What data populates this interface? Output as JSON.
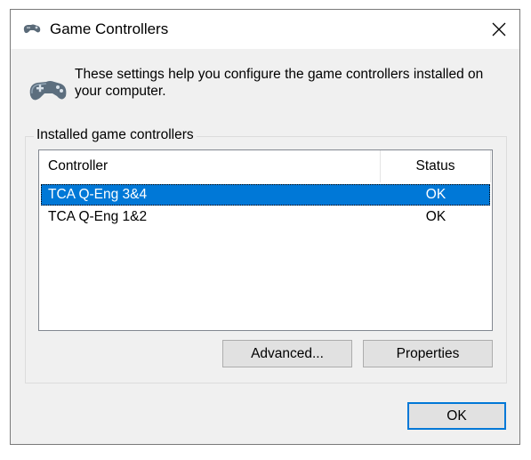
{
  "window": {
    "title": "Game Controllers",
    "title_icon": "gamepad-icon",
    "close_icon": "close-icon"
  },
  "info": {
    "icon": "gamepad-icon",
    "text": "These settings help you configure the game controllers installed on your computer."
  },
  "group": {
    "label": "Installed game controllers"
  },
  "list": {
    "columns": [
      "Controller",
      "Status"
    ],
    "rows": [
      {
        "controller": "TCA Q-Eng 3&4",
        "status": "OK",
        "selected": true
      },
      {
        "controller": "TCA Q-Eng 1&2",
        "status": "OK",
        "selected": false
      }
    ]
  },
  "buttons": {
    "advanced": "Advanced...",
    "properties": "Properties",
    "ok": "OK"
  },
  "colors": {
    "selection": "#0078d7",
    "dialog_bg": "#f0f0f0"
  }
}
